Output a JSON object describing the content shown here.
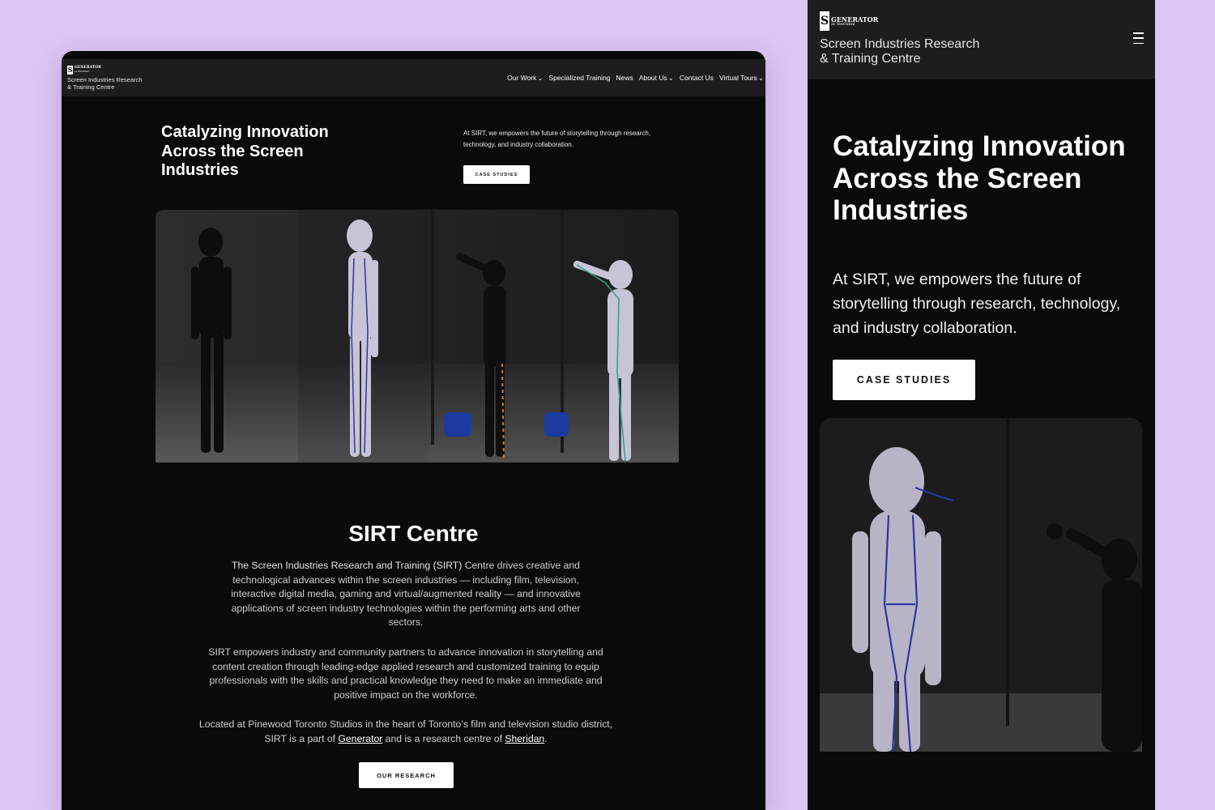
{
  "brand": {
    "logo_letter": "S",
    "logo_word": "GENERATOR",
    "logo_sub": "at Sheridan",
    "name_line1": "Screen Industries Research",
    "name_line2": "& Training Centre"
  },
  "nav": {
    "items": [
      {
        "label": "Our Work",
        "dropdown": true
      },
      {
        "label": "Specialized Training",
        "dropdown": false
      },
      {
        "label": "News",
        "dropdown": false
      },
      {
        "label": "About Us",
        "dropdown": true
      },
      {
        "label": "Contact Us",
        "dropdown": false
      },
      {
        "label": "Virtual Tours",
        "dropdown": true
      }
    ],
    "caret": "⌄"
  },
  "hero": {
    "title_line1": "Catalyzing Innovation",
    "title_line2": "Across the Screen",
    "title_line3": "Industries",
    "description": "At SIRT, we empowers the future of storytelling through research, technology, and industry collaboration.",
    "cta_label": "CASE STUDIES"
  },
  "about": {
    "title": "SIRT Centre",
    "p1_strong": "The Screen Industries Research and Training (SIRT)",
    "p1_rest": " Centre drives creative and technological advances within the screen industries — including film, television, interactive digital media, gaming and virtual/augmented reality — and innovative applications of screen industry technologies within the performing arts and other sectors.",
    "p2": "SIRT empowers industry and community partners to advance innovation in storytelling and content creation through leading-edge applied research and customized training to equip professionals with the skills and practical knowledge they need to make an immediate and positive impact on the workforce.",
    "p3_a": "Located at Pinewood Toronto Studios in the heart of Toronto’s film and television studio district, SIRT is a part of ",
    "p3_link1": "Generator",
    "p3_b": " and is a research centre of ",
    "p3_link2": "Sheridan",
    "p3_c": ".",
    "cta_label": "OUR RESEARCH"
  },
  "colors": {
    "page_bg": "#dcc6f3",
    "site_bg": "#0a0a0a",
    "header_bg": "#1d1d1f",
    "button_bg": "#ffffff"
  },
  "icons": {
    "menu": "hamburger-icon"
  }
}
